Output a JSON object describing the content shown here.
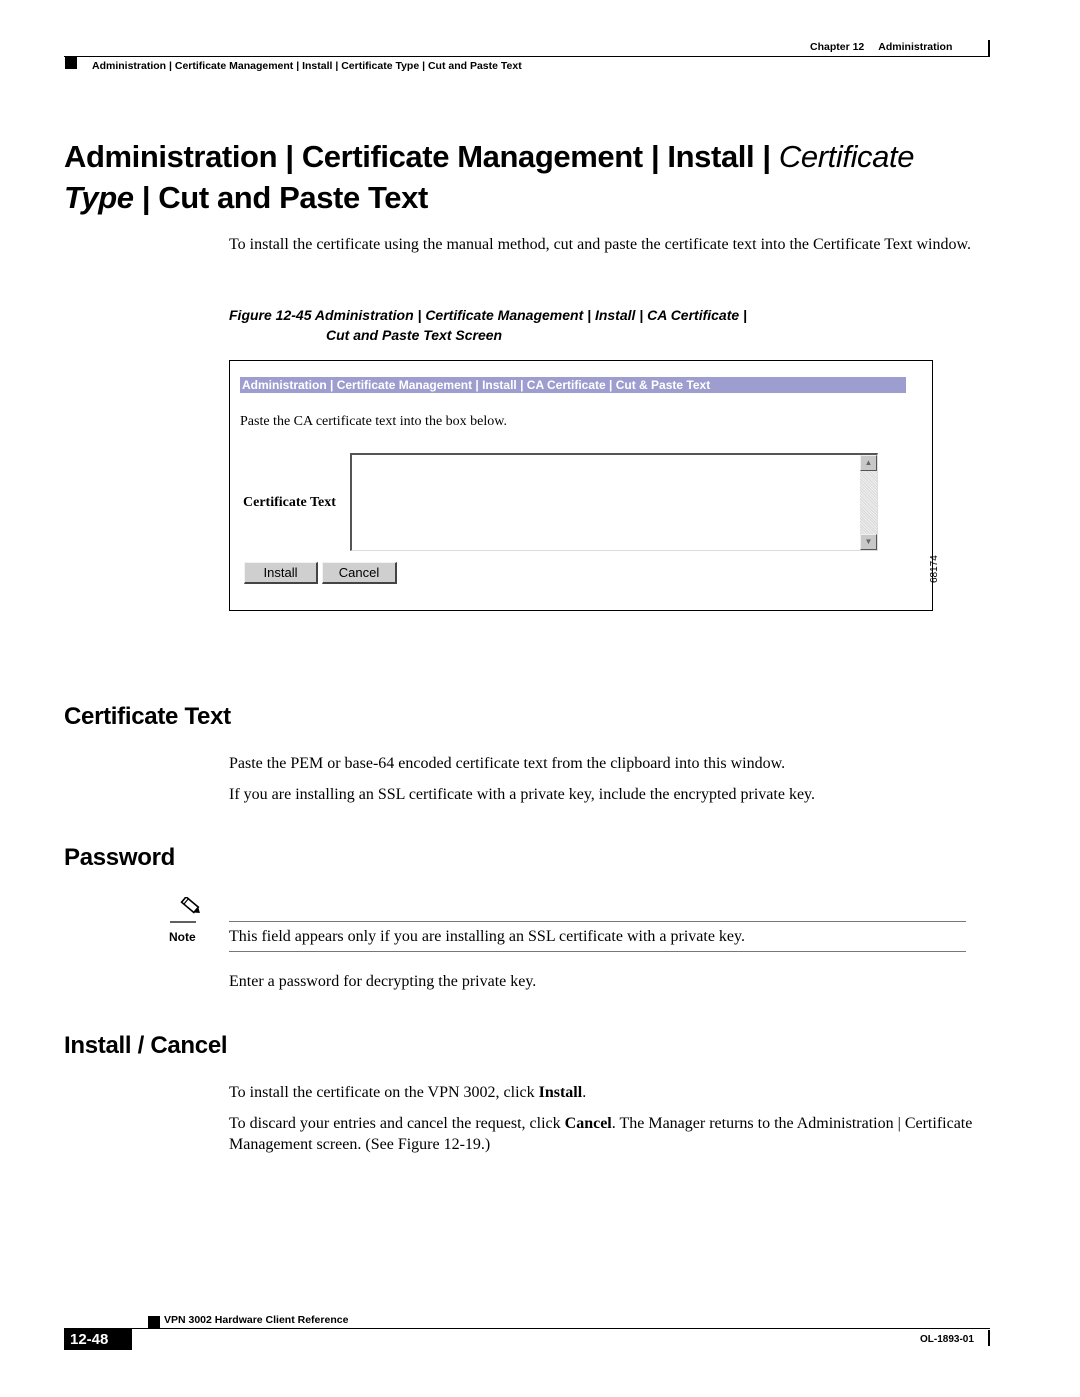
{
  "header": {
    "chapter": "Chapter 12",
    "chapter_title": "Administration",
    "breadcrumb": "Administration | Certificate Management | Install | Certificate Type | Cut and Paste Text"
  },
  "title": {
    "part1": "Administration | Certificate Management | Install | ",
    "italic1": "Certificate",
    "italic2": "Type",
    "part2": " | Cut and Paste Text"
  },
  "intro": "To install the certificate using the manual method, cut and paste the certificate text into the Certificate Text window.",
  "figure": {
    "caption_line1": "Figure 12-45 Administration | Certificate Management | Install | CA Certificate |",
    "caption_line2": "Cut and Paste Text Screen",
    "screen": {
      "title_bar": "Administration | Certificate Management | Install | CA Certificate | Cut & Paste Text",
      "instruction": "Paste the CA certificate text into the box below.",
      "field_label": "Certificate Text",
      "field_value": "",
      "install_button": "Install",
      "cancel_button": "Cancel",
      "bar_color": "#9d9dcf"
    },
    "figure_id": "68174"
  },
  "sections": {
    "certificate_text": {
      "heading": "Certificate Text",
      "p1": "Paste the PEM or base-64 encoded certificate text from the clipboard into this window.",
      "p2": "If you are installing an SSL certificate with a private key, include the encrypted private key."
    },
    "password": {
      "heading": "Password",
      "note_label": "Note",
      "note_text": "This field appears only if you are installing an SSL certificate with a private key.",
      "p1": "Enter a password for decrypting the private key."
    },
    "install_cancel": {
      "heading": "Install / Cancel",
      "p1_before": "To install the certificate on the VPN 3002, click ",
      "p1_bold": "Install",
      "p1_after": ".",
      "p2_before": "To discard your entries and cancel the request, click ",
      "p2_bold": "Cancel",
      "p2_after": ". The Manager returns to the Administration | Certificate Management screen. (See Figure 12-19.)"
    }
  },
  "footer": {
    "book_title": "VPN 3002 Hardware Client Reference",
    "page_number": "12-48",
    "doc_number": "OL-1893-01"
  }
}
